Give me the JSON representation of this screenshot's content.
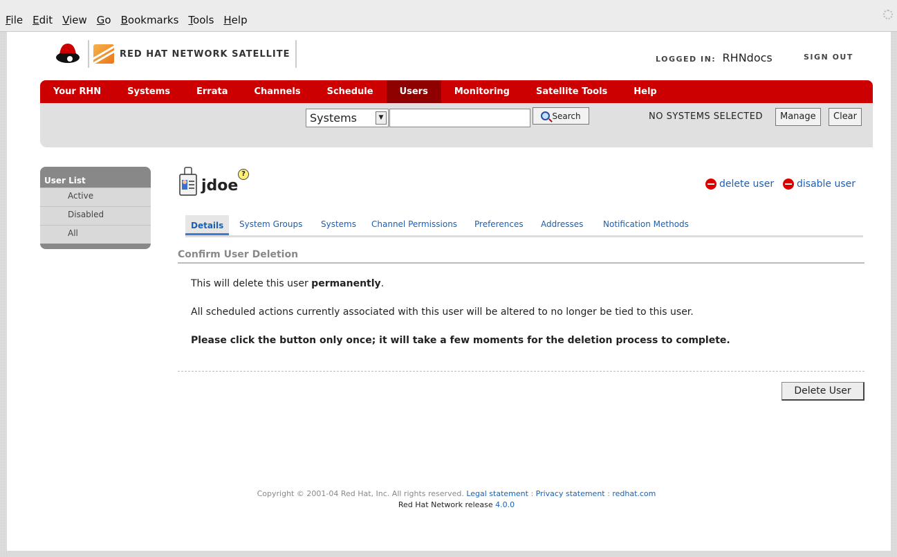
{
  "browser_menu": [
    "File",
    "Edit",
    "View",
    "Go",
    "Bookmarks",
    "Tools",
    "Help"
  ],
  "header": {
    "logo_text": "RED HAT NETWORK SATELLITE",
    "logged_in_label": "LOGGED IN:",
    "username": "RHNdocs",
    "sign_out": "SIGN OUT"
  },
  "nav": {
    "tabs": [
      "Your RHN",
      "Systems",
      "Errata",
      "Channels",
      "Schedule",
      "Users",
      "Monitoring",
      "Satellite Tools",
      "Help"
    ],
    "active": "Users"
  },
  "search": {
    "scope_selected": "Systems",
    "query": "",
    "button_label": "Search",
    "system_status": "NO SYSTEMS SELECTED",
    "manage_label": "Manage",
    "clear_label": "Clear"
  },
  "sidebar": {
    "heading": "User List",
    "items": [
      "Active",
      "Disabled",
      "All"
    ]
  },
  "user": {
    "name": "jdoe",
    "help_glyph": "?",
    "delete_link": "delete user",
    "disable_link": "disable user"
  },
  "tabs": [
    "Details",
    "System Groups",
    "Systems",
    "Channel Permissions",
    "Preferences",
    "Addresses",
    "Notification Methods"
  ],
  "confirm": {
    "title": "Confirm User Deletion",
    "line1_prefix": "This will delete this user ",
    "line1_bold": "permanently",
    "line1_suffix": ".",
    "line2": "All scheduled actions currently associated with this user will be altered to no longer be tied to this user.",
    "line3": "Please click the button only once; it will take a few moments for the deletion process to complete.",
    "button_label": "Delete User"
  },
  "footer": {
    "copyright": "Copyright © 2001-04 Red Hat, Inc. All rights reserved.",
    "legal": "Legal statement",
    "sep1": " : ",
    "privacy": "Privacy statement",
    "sep2": " : ",
    "redhat": "redhat.com",
    "release_prefix": "Red Hat Network release ",
    "release_version": "4.0.0"
  },
  "colors": {
    "nav_red": "#cc0000",
    "nav_active": "#8f0000",
    "link_blue": "#1a5fb4"
  }
}
